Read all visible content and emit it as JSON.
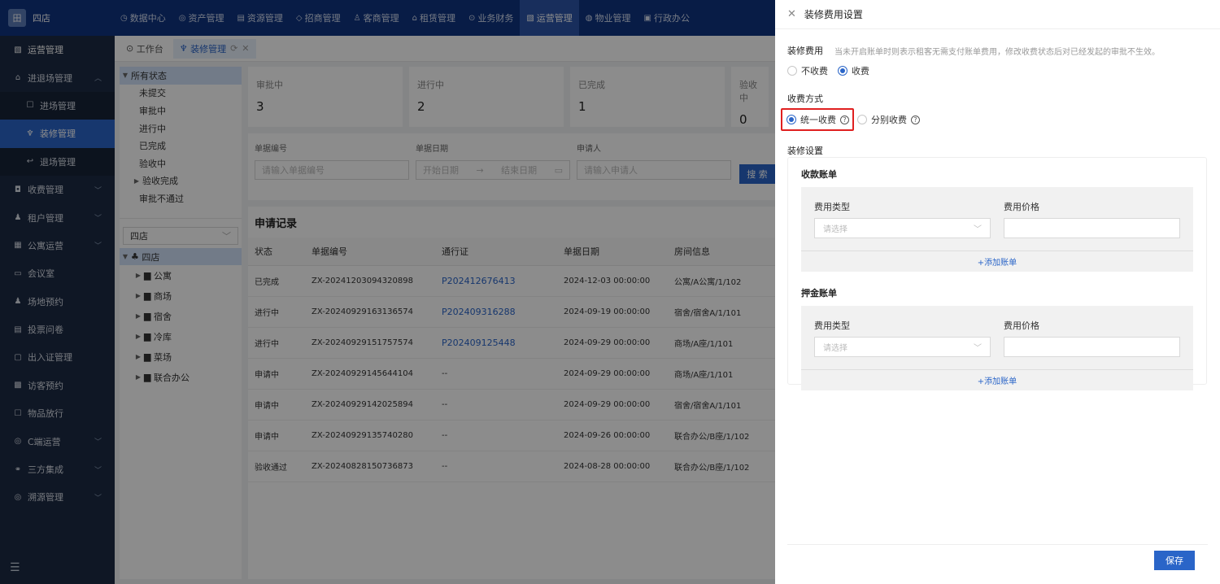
{
  "app": {
    "logo_text": "四店",
    "logo_mark": "田"
  },
  "topnav": [
    {
      "icon": "◷",
      "label": "数据中心"
    },
    {
      "icon": "◎",
      "label": "资产管理"
    },
    {
      "icon": "▤",
      "label": "资源管理"
    },
    {
      "icon": "◇",
      "label": "招商管理"
    },
    {
      "icon": "♙",
      "label": "客商管理"
    },
    {
      "icon": "⌂",
      "label": "租赁管理"
    },
    {
      "icon": "⊙",
      "label": "业务财务"
    },
    {
      "icon": "▧",
      "label": "运营管理"
    },
    {
      "icon": "◍",
      "label": "物业管理"
    },
    {
      "icon": "▣",
      "label": "行政办公"
    }
  ],
  "sidebar": {
    "items": [
      {
        "icon": "▧",
        "label": "运营管理"
      },
      {
        "icon": "⌂",
        "label": "进退场管理"
      },
      {
        "icon": "☐",
        "label": "进场管理"
      },
      {
        "icon": "♆",
        "label": "装修管理"
      },
      {
        "icon": "↩",
        "label": "退场管理"
      },
      {
        "icon": "◘",
        "label": "收费管理"
      },
      {
        "icon": "♟",
        "label": "租户管理"
      },
      {
        "icon": "▦",
        "label": "公寓运营"
      },
      {
        "icon": "▭",
        "label": "会议室"
      },
      {
        "icon": "♟",
        "label": "场地预约"
      },
      {
        "icon": "▤",
        "label": "投票问卷"
      },
      {
        "icon": "▢",
        "label": "出入证管理"
      },
      {
        "icon": "▩",
        "label": "访客预约"
      },
      {
        "icon": "☐",
        "label": "物品放行"
      },
      {
        "icon": "◎",
        "label": "C端运营"
      },
      {
        "icon": "⚭",
        "label": "三方集成"
      },
      {
        "icon": "◎",
        "label": "溯源管理"
      }
    ],
    "collapse_icon": "☰"
  },
  "tabs": [
    {
      "label": "工作台"
    },
    {
      "label": "装修管理"
    }
  ],
  "status_tree": {
    "root": "所有状态",
    "children": [
      "未提交",
      "审批中",
      "进行中",
      "已完成",
      "验收中",
      "验收完成",
      "审批不通过"
    ]
  },
  "store_select": "四店",
  "org_tree": {
    "root": "四店",
    "children": [
      "公寓",
      "商场",
      "宿舍",
      "冷库",
      "菜场",
      "联合办公"
    ]
  },
  "stats": [
    {
      "label": "审批中",
      "value": "3"
    },
    {
      "label": "进行中",
      "value": "2"
    },
    {
      "label": "已完成",
      "value": "1"
    },
    {
      "label": "验收中",
      "value": "0"
    }
  ],
  "filter": {
    "labels": [
      "单据编号",
      "单据日期",
      "申请人"
    ],
    "code_placeholder": "请输入单据编号",
    "start_placeholder": "开始日期",
    "end_placeholder": "结束日期",
    "applicant_placeholder": "请输入申请人",
    "search_label": "搜 索"
  },
  "records": {
    "title": "申请记录",
    "columns": [
      "状态",
      "单据编号",
      "通行证",
      "单据日期",
      "房间信息"
    ],
    "rows": [
      [
        "已完成",
        "ZX-20241203094320898",
        "P202412676413",
        "2024-12-03 00:00:00",
        "公寓/A公寓/1/102"
      ],
      [
        "进行中",
        "ZX-20240929163136574",
        "P202409316288",
        "2024-09-19 00:00:00",
        "宿舍/宿舍A/1/101"
      ],
      [
        "进行中",
        "ZX-20240929151757574",
        "P202409125448",
        "2024-09-29 00:00:00",
        "商场/A座/1/101"
      ],
      [
        "申请中",
        "ZX-20240929145644104",
        "--",
        "2024-09-29 00:00:00",
        "商场/A座/1/101"
      ],
      [
        "申请中",
        "ZX-20240929142025894",
        "--",
        "2024-09-29 00:00:00",
        "宿舍/宿舍A/1/101"
      ],
      [
        "申请中",
        "ZX-20240929135740280",
        "--",
        "2024-09-26 00:00:00",
        "联合办公/B座/1/102"
      ],
      [
        "验收通过",
        "ZX-20240828150736873",
        "--",
        "2024-08-28 00:00:00",
        "联合办公/B座/1/102"
      ]
    ]
  },
  "drawer": {
    "title": "装修费用设置",
    "fee_label": "装修费用",
    "fee_hint": "当未开启账单时则表示租客无需支付账单费用，修改收费状态后对已经发起的审批不生效。",
    "fee_options": [
      "不收费",
      "收费"
    ],
    "method_label": "收费方式",
    "method_options": [
      "统一收费",
      "分别收费"
    ],
    "settings_label": "装修设置",
    "bills": [
      {
        "title": "收款账单",
        "type_label": "费用类型",
        "price_label": "费用价格",
        "placeholder": "请选择",
        "add_label": "+添加账单"
      },
      {
        "title": "押金账单",
        "type_label": "费用类型",
        "price_label": "费用价格",
        "placeholder": "请选择",
        "add_label": "+添加账单"
      }
    ],
    "save_label": "保存"
  }
}
